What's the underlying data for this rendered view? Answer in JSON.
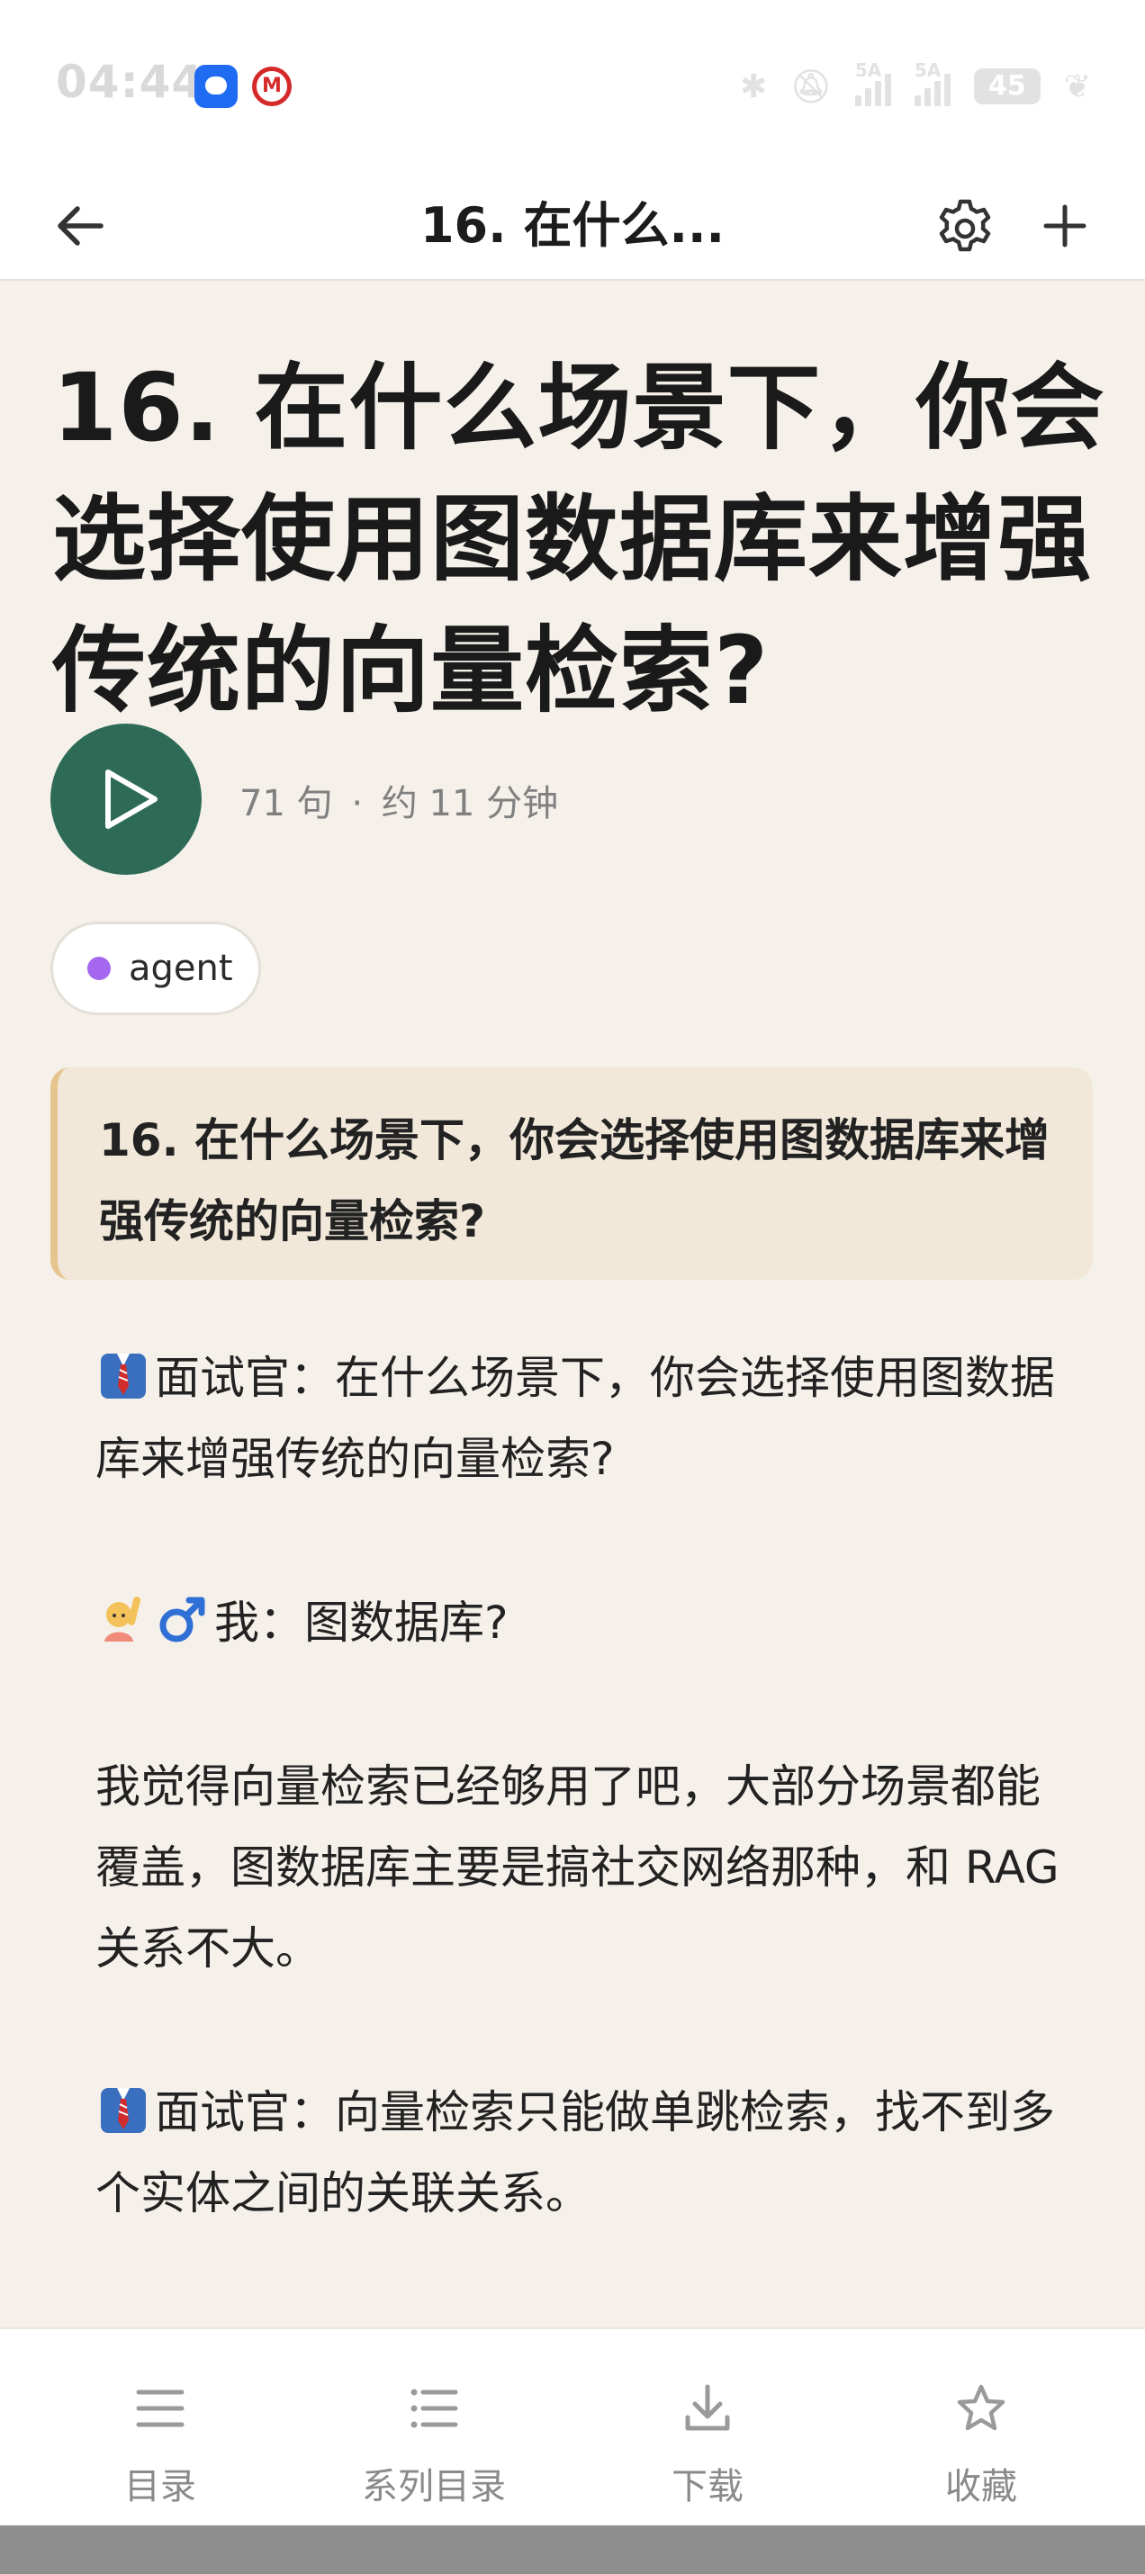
{
  "status_bar": {
    "time": "04:44",
    "network_1": "5A",
    "network_2": "5A",
    "battery": "45"
  },
  "nav": {
    "title": "16. 在什么..."
  },
  "article": {
    "headline": "16. 在什么场景下，你会选择使用图数据库来增强传统的向量检索?",
    "sentence_count": "71 句",
    "separator": "·",
    "duration": "约 11 分钟",
    "tag": "agent",
    "quote": "16. 在什么场景下，你会选择使用图数据库来增强传统的向量检索?",
    "paragraphs": [
      {
        "emoji": "necktie-person",
        "text": "面试官：在什么场景下，你会选择使用图数据库来增强传统的向量检索?"
      },
      {
        "emoji": "raising-hand-man",
        "text": "我：图数据库?"
      },
      {
        "emoji": "",
        "text": "我觉得向量检索已经够用了吧，大部分场景都能覆盖，图数据库主要是搞社交网络那种，和 RAG 关系不大。"
      },
      {
        "emoji": "necktie-person",
        "text": "面试官：向量检索只能做单跳检索，找不到多个实体之间的关联关系。"
      }
    ]
  },
  "toolbar": {
    "items": [
      {
        "label": "目录",
        "icon": "menu-icon"
      },
      {
        "label": "系列目录",
        "icon": "list-icon"
      },
      {
        "label": "下载",
        "icon": "download-icon"
      },
      {
        "label": "收藏",
        "icon": "star-icon"
      }
    ]
  },
  "colors": {
    "background": "#f5f1ea",
    "play_button": "#2e6b57",
    "tag_dot": "#a667f0",
    "quote_bg": "#f1e8da",
    "quote_border": "#e6c48e"
  }
}
